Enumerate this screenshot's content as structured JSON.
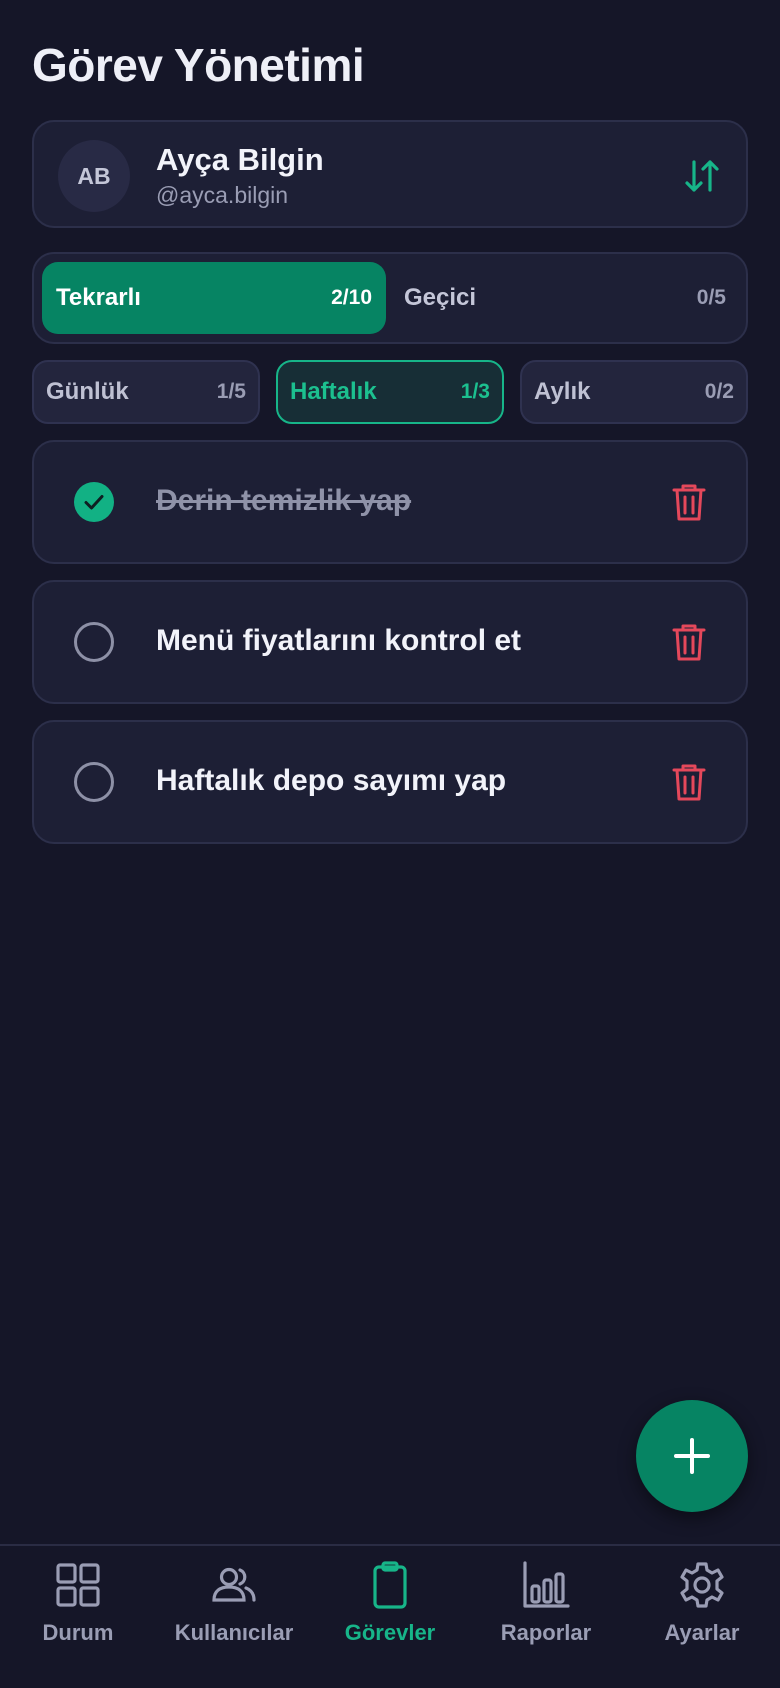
{
  "page": {
    "title": "Görev Yönetimi"
  },
  "user": {
    "initials": "AB",
    "name": "Ayça Bilgin",
    "handle": "@ayca.bilgin",
    "switch_icon": "swap-vertical-icon"
  },
  "type_tabs": [
    {
      "label": "Tekrarlı",
      "count": "2/10",
      "active": true
    },
    {
      "label": "Geçici",
      "count": "0/5",
      "active": false
    }
  ],
  "period_tabs": [
    {
      "label": "Günlük",
      "count": "1/5",
      "active": false
    },
    {
      "label": "Haftalık",
      "count": "1/3",
      "active": true
    },
    {
      "label": "Aylık",
      "count": "0/2",
      "active": false
    }
  ],
  "tasks": [
    {
      "text": "Derin temizlik yap",
      "done": true
    },
    {
      "text": "Menü fiyatlarını kontrol et",
      "done": false
    },
    {
      "text": "Haftalık depo sayımı yap",
      "done": false
    }
  ],
  "fab": {
    "icon": "plus-icon"
  },
  "nav": [
    {
      "label": "Durum",
      "icon": "grid-icon",
      "active": false
    },
    {
      "label": "Kullanıcılar",
      "icon": "users-icon",
      "active": false
    },
    {
      "label": "Görevler",
      "icon": "clipboard-icon",
      "active": true
    },
    {
      "label": "Raporlar",
      "icon": "bar-chart-icon",
      "active": false
    },
    {
      "label": "Ayarlar",
      "icon": "gear-icon",
      "active": false
    }
  ],
  "colors": {
    "background": "#151628",
    "card": "#1D1F35",
    "accent": "#068463",
    "accent_text": "#17B589",
    "danger": "#E5485B"
  }
}
